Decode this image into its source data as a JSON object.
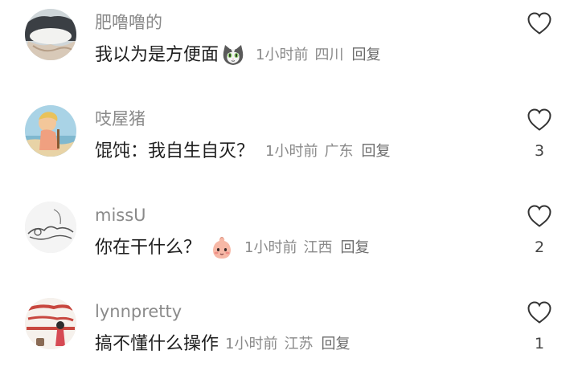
{
  "comments": [
    {
      "username": "肥噜噜的",
      "text": "我以为是方便面",
      "emoji": "tabby-cat-emoji",
      "time": "1小时前",
      "region": "四川",
      "reply_label": "回复",
      "like_count": ""
    },
    {
      "username": "吱屋猪",
      "text": "馄饨：我自生自灭？",
      "emoji": "",
      "time": "1小时前",
      "region": "广东",
      "reply_label": "回复",
      "like_count": "3"
    },
    {
      "username": "missU",
      "text": "你在干什么？",
      "emoji": "pink-baby-face-emoji",
      "time": "1小时前",
      "region": "江西",
      "reply_label": "回复",
      "like_count": "2"
    },
    {
      "username": "lynnpretty",
      "text": "搞不懂什么操作",
      "emoji": "",
      "time": "1小时前",
      "region": "江苏",
      "reply_label": "回复",
      "like_count": "1"
    }
  ],
  "icons": {
    "like": "heart-outline-icon"
  },
  "colors": {
    "username": "#8a8a8a",
    "text": "#1f1f1f",
    "meta": "#8a8a8a",
    "count": "#444444"
  }
}
